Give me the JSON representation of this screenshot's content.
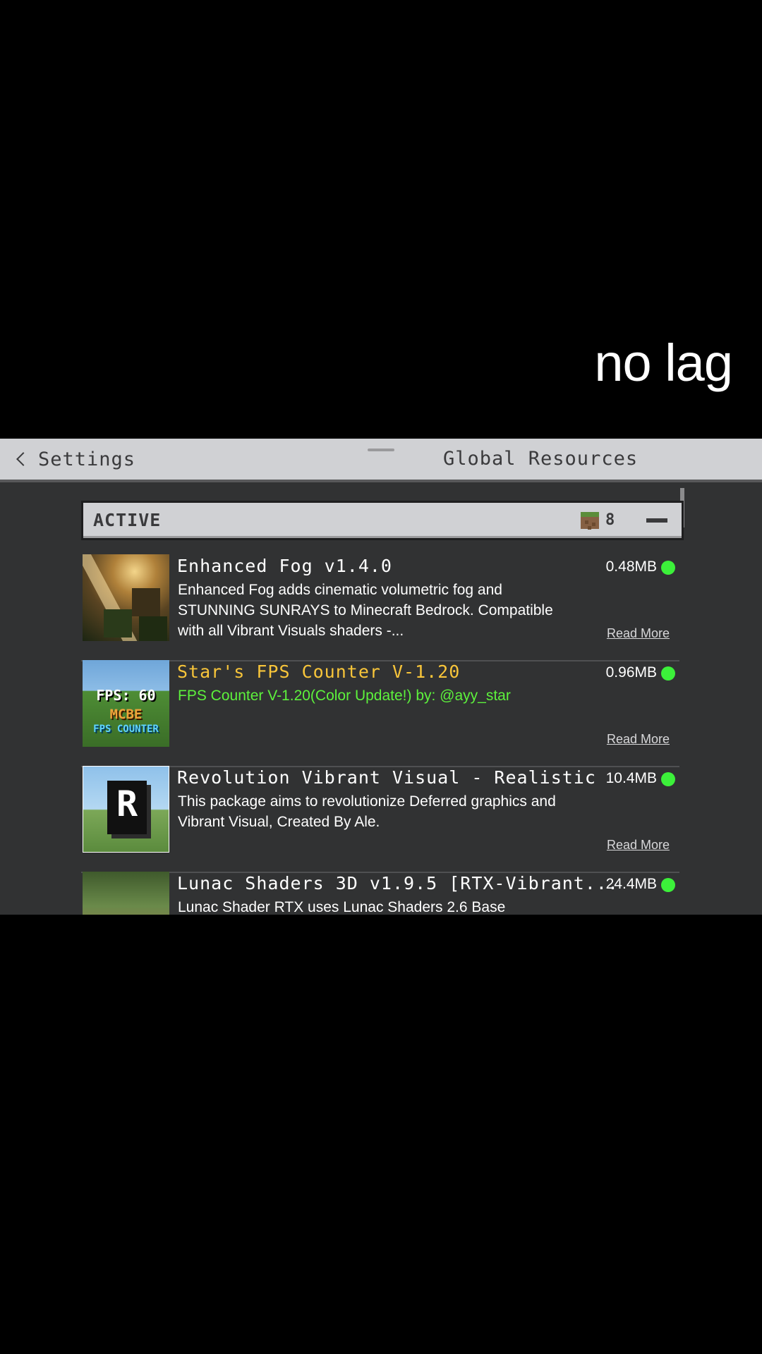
{
  "overlay": {
    "caption": "no lag"
  },
  "header": {
    "back_label": "Settings",
    "title": "Global Resources"
  },
  "section": {
    "title": "ACTIVE",
    "count": "8"
  },
  "packs": [
    {
      "title": "Enhanced Fog v1.4.0",
      "description": "Enhanced Fog adds cinematic volumetric fog and STUNNING SUNRAYS to Minecraft Bedrock. Compatible with all Vibrant Visuals shaders -...",
      "size": "0.48MB",
      "read_more": "Read More",
      "icon": "sunrays-thumbnail"
    },
    {
      "title": "Star's FPS Counter V-1.20",
      "description": "FPS Counter V-1.20(Color Update!) by: @ayy_star",
      "size": "0.96MB",
      "read_more": "Read More",
      "icon": "fps-counter-thumbnail",
      "thumb_text": [
        "FPS: 60",
        "MCBE",
        "FPS COUNTER"
      ]
    },
    {
      "title": "Revolution Vibrant Visual - Realistic",
      "description": "This package aims to revolutionize Deferred graphics and Vibrant Visual, Created By Ale.",
      "size": "10.4MB",
      "read_more": "Read More",
      "icon": "revolution-logo-thumbnail",
      "thumb_text": [
        "R"
      ]
    },
    {
      "title": "Lunac Shaders 3D v1.9.5 [RTX-Vibrant...",
      "description": "Lunac Shader RTX uses Lunac Shaders 2.6 Base",
      "size": "24.4MB",
      "icon": "garden-thumbnail"
    }
  ],
  "colors": {
    "panel_bg": "#313233",
    "header_bg": "#d0d1d4",
    "status_active": "#3cf03a",
    "gold_title": "#f8c53a",
    "green_desc": "#5df23c"
  }
}
